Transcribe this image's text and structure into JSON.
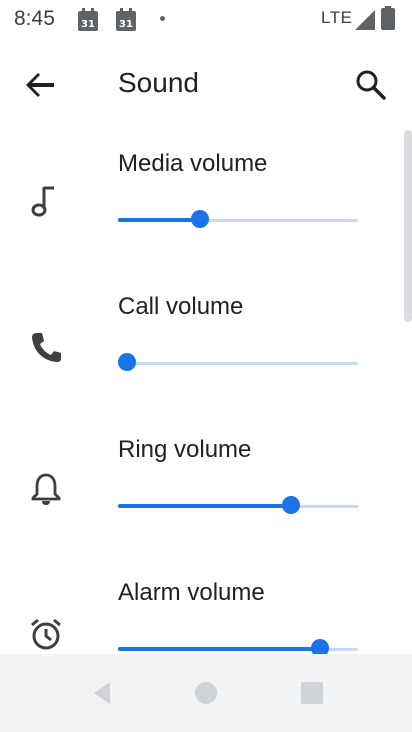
{
  "status_bar": {
    "time": "8:45",
    "network": "LTE",
    "icons": [
      "calendar-31-icon",
      "calendar-31-icon",
      "signal-icon",
      "battery-icon"
    ],
    "calendar_day": "31"
  },
  "app_bar": {
    "title": "Sound",
    "back_icon": "arrow-back-icon",
    "search_icon": "search-icon"
  },
  "settings": [
    {
      "label": "Media volume",
      "icon": "music-note-icon",
      "level": 0.34
    },
    {
      "label": "Call volume",
      "icon": "phone-icon",
      "level": 0.0
    },
    {
      "label": "Ring volume",
      "icon": "bell-icon",
      "level": 0.72
    },
    {
      "label": "Alarm volume",
      "icon": "alarm-icon",
      "level": 0.84
    }
  ],
  "nav_bar": {
    "back_icon": "nav-back-icon",
    "home_icon": "nav-home-icon",
    "recents_icon": "nav-recents-icon"
  },
  "colors": {
    "accent": "#1a73e8",
    "track": "#c5d9f7",
    "nav_background": "#f1f3f4"
  }
}
